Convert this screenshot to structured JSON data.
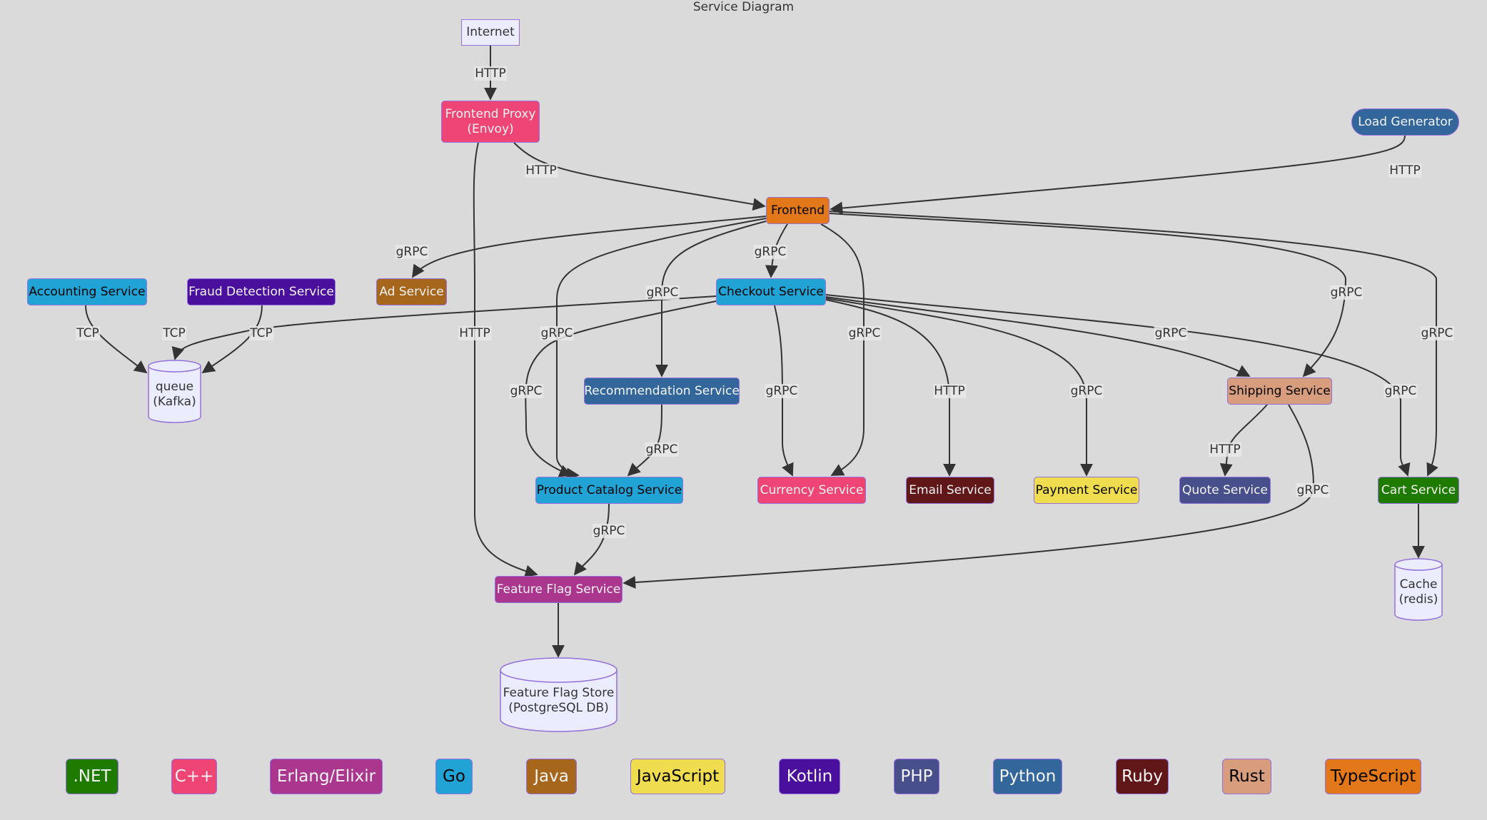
{
  "title": "Service Diagram",
  "nodes": {
    "internet": {
      "label": "Internet",
      "fill": "#ececff",
      "text": "#333333"
    },
    "frontend_proxy": {
      "label": "Frontend Proxy\n(Envoy)",
      "fill": "#ef4574",
      "text": "#f5f5f5"
    },
    "load_generator": {
      "label": "Load Generator",
      "fill": "#33669a",
      "text": "#f5f5f5"
    },
    "frontend": {
      "label": "Frontend",
      "fill": "#e2781a",
      "text": "#000000"
    },
    "accounting": {
      "label": "Accounting Service",
      "fill": "#22a3d6",
      "text": "#000000"
    },
    "fraud_detection": {
      "label": "Fraud Detection Service",
      "fill": "#4a0f9c",
      "text": "#f5f5f5"
    },
    "ad": {
      "label": "Ad Service",
      "fill": "#a6661c",
      "text": "#f5f5f5"
    },
    "checkout": {
      "label": "Checkout Service",
      "fill": "#22a3d6",
      "text": "#000000"
    },
    "recommendation": {
      "label": "Recommendation Service",
      "fill": "#33669a",
      "text": "#f5f5f5"
    },
    "shipping": {
      "label": "Shipping Service",
      "fill": "#d89d7c",
      "text": "#000000"
    },
    "product_catalog": {
      "label": "Product Catalog Service",
      "fill": "#22a3d6",
      "text": "#000000"
    },
    "currency": {
      "label": "Currency Service",
      "fill": "#ef4574",
      "text": "#f5f5f5"
    },
    "email": {
      "label": "Email Service",
      "fill": "#611718",
      "text": "#f5f5f5"
    },
    "payment": {
      "label": "Payment Service",
      "fill": "#f0dc4f",
      "text": "#000000"
    },
    "quote": {
      "label": "Quote Service",
      "fill": "#47508b",
      "text": "#f5f5f5"
    },
    "cart": {
      "label": "Cart Service",
      "fill": "#1e7b00",
      "text": "#f5f5f5"
    },
    "feature_flag": {
      "label": "Feature Flag Service",
      "fill": "#aa368e",
      "text": "#f5f5f5"
    },
    "queue": {
      "label": "queue\n(Kafka)",
      "fill": "#ececff",
      "text": "#333333"
    },
    "cache": {
      "label": "Cache\n(redis)",
      "fill": "#ececff",
      "text": "#333333"
    },
    "feature_flag_store": {
      "label": "Feature Flag Store\n(PostgreSQL DB)",
      "fill": "#ececff",
      "text": "#333333"
    }
  },
  "edges": [
    {
      "from": "internet",
      "to": "frontend_proxy",
      "label": "HTTP"
    },
    {
      "from": "frontend_proxy",
      "to": "frontend",
      "label": "HTTP"
    },
    {
      "from": "frontend_proxy",
      "to": "feature_flag",
      "label": "HTTP"
    },
    {
      "from": "load_generator",
      "to": "frontend",
      "label": "HTTP"
    },
    {
      "from": "frontend",
      "to": "ad",
      "label": "gRPC"
    },
    {
      "from": "frontend",
      "to": "checkout",
      "label": "gRPC"
    },
    {
      "from": "frontend",
      "to": "recommendation",
      "label": "gRPC"
    },
    {
      "from": "frontend",
      "to": "product_catalog",
      "label": "gRPC"
    },
    {
      "from": "frontend",
      "to": "currency",
      "label": "gRPC"
    },
    {
      "from": "frontend",
      "to": "shipping",
      "label": "gRPC"
    },
    {
      "from": "frontend",
      "to": "cart",
      "label": "gRPC"
    },
    {
      "from": "accounting",
      "to": "queue",
      "label": "TCP"
    },
    {
      "from": "checkout",
      "to": "queue",
      "label": "TCP"
    },
    {
      "from": "fraud_detection",
      "to": "queue",
      "label": "TCP"
    },
    {
      "from": "checkout",
      "to": "product_catalog",
      "label": "gRPC"
    },
    {
      "from": "checkout",
      "to": "currency",
      "label": "gRPC"
    },
    {
      "from": "checkout",
      "to": "email",
      "label": "HTTP"
    },
    {
      "from": "checkout",
      "to": "payment",
      "label": "gRPC"
    },
    {
      "from": "checkout",
      "to": "shipping",
      "label": "gRPC"
    },
    {
      "from": "checkout",
      "to": "cart",
      "label": "gRPC"
    },
    {
      "from": "recommendation",
      "to": "product_catalog",
      "label": "gRPC"
    },
    {
      "from": "product_catalog",
      "to": "feature_flag",
      "label": "gRPC"
    },
    {
      "from": "shipping",
      "to": "quote",
      "label": "HTTP"
    },
    {
      "from": "shipping",
      "to": "feature_flag",
      "label": "gRPC"
    },
    {
      "from": "cart",
      "to": "cache",
      "label": ""
    },
    {
      "from": "feature_flag",
      "to": "feature_flag_store",
      "label": ""
    }
  ],
  "legend": [
    {
      "label": ".NET",
      "fill": "#1e7b00",
      "text": "#f5f5f5"
    },
    {
      "label": "C++",
      "fill": "#ef4574",
      "text": "#f5f5f5"
    },
    {
      "label": "Erlang/Elixir",
      "fill": "#aa368e",
      "text": "#f5f5f5"
    },
    {
      "label": "Go",
      "fill": "#22a3d6",
      "text": "#000000"
    },
    {
      "label": "Java",
      "fill": "#a6661c",
      "text": "#f5f5f5"
    },
    {
      "label": "JavaScript",
      "fill": "#f0dc4f",
      "text": "#000000"
    },
    {
      "label": "Kotlin",
      "fill": "#4a0f9c",
      "text": "#f5f5f5"
    },
    {
      "label": "PHP",
      "fill": "#47508b",
      "text": "#f5f5f5"
    },
    {
      "label": "Python",
      "fill": "#33669a",
      "text": "#f5f5f5"
    },
    {
      "label": "Ruby",
      "fill": "#611718",
      "text": "#f5f5f5"
    },
    {
      "label": "Rust",
      "fill": "#d89d7c",
      "text": "#000000"
    },
    {
      "label": "TypeScript",
      "fill": "#e2781a",
      "text": "#000000"
    }
  ]
}
